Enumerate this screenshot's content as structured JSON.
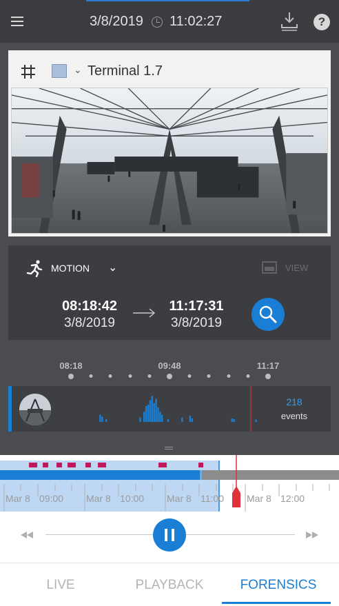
{
  "header": {
    "date": "3/8/2019",
    "time": "11:02:27"
  },
  "camera": {
    "name": "Terminal 1.7",
    "swatch_color": "#a8bedc"
  },
  "search": {
    "filter_label": "MOTION",
    "view_label": "VIEW",
    "start_time": "08:18:42",
    "start_date": "3/8/2019",
    "end_time": "11:17:31",
    "end_date": "3/8/2019"
  },
  "histogram": {
    "scale_labels": [
      "08:18",
      "09:48",
      "11:17"
    ],
    "events_count": "218",
    "events_label": "events",
    "bars": [
      {
        "t": 0.18,
        "v": 0.25
      },
      {
        "t": 0.19,
        "v": 0.18
      },
      {
        "t": 0.21,
        "v": 0.1
      },
      {
        "t": 0.38,
        "v": 0.15
      },
      {
        "t": 0.4,
        "v": 0.35
      },
      {
        "t": 0.41,
        "v": 0.55
      },
      {
        "t": 0.42,
        "v": 0.6
      },
      {
        "t": 0.43,
        "v": 0.75
      },
      {
        "t": 0.44,
        "v": 0.9
      },
      {
        "t": 0.45,
        "v": 0.65
      },
      {
        "t": 0.46,
        "v": 0.8
      },
      {
        "t": 0.47,
        "v": 0.5
      },
      {
        "t": 0.48,
        "v": 0.35
      },
      {
        "t": 0.49,
        "v": 0.25
      },
      {
        "t": 0.52,
        "v": 0.1
      },
      {
        "t": 0.59,
        "v": 0.15
      },
      {
        "t": 0.63,
        "v": 0.22
      },
      {
        "t": 0.64,
        "v": 0.12
      },
      {
        "t": 0.84,
        "v": 0.12
      },
      {
        "t": 0.85,
        "v": 0.1
      },
      {
        "t": 0.96,
        "v": 0.08
      }
    ],
    "colors": {
      "bar": "#1a7fd4",
      "cursor": "#e0303a"
    }
  },
  "timeline": {
    "labels": [
      "Mar 8",
      "09:00",
      "Mar 8",
      "10:00",
      "Mar 8",
      "11:00",
      "Mar 8",
      "12:00"
    ],
    "colors": {
      "selection": "#a8cbf0",
      "recording": "#1a7fd4",
      "gap": "#8c8c8c",
      "event": "#c0185a",
      "playhead": "#e0303a"
    }
  },
  "playback": {
    "state": "playing"
  },
  "tabs": [
    {
      "label": "LIVE",
      "active": false
    },
    {
      "label": "PLAYBACK",
      "active": false
    },
    {
      "label": "FORENSICS",
      "active": true
    }
  ]
}
